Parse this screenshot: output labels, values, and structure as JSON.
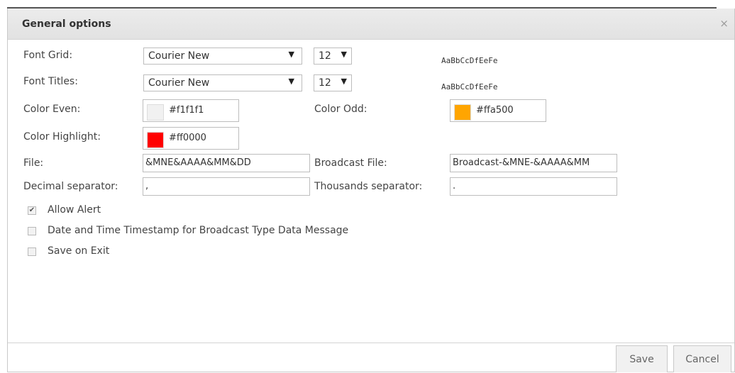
{
  "dialog": {
    "title": "General options",
    "close_icon": "×"
  },
  "form": {
    "font_grid": {
      "label": "Font Grid:",
      "font": "Courier New",
      "size": "12",
      "sample": "AaBbCcDfEeFe"
    },
    "font_titles": {
      "label": "Font Titles:",
      "font": "Courier New",
      "size": "12",
      "sample": "AaBbCcDfEeFe"
    },
    "color_even": {
      "label": "Color Even:",
      "value": "#f1f1f1",
      "swatch": "#f1f1f1"
    },
    "color_odd": {
      "label": "Color Odd:",
      "value": "#ffa500",
      "swatch": "#ffa500"
    },
    "color_highlight": {
      "label": "Color Highlight:",
      "value": "#ff0000",
      "swatch": "#ff0000"
    },
    "file": {
      "label": "File:",
      "value": "&MNE&AAAA&MM&DD"
    },
    "broadcast_file": {
      "label": "Broadcast File:",
      "value": "Broadcast-&MNE-&AAAA&MM"
    },
    "decimal_separator": {
      "label": "Decimal separator:",
      "value": ","
    },
    "thousands_separator": {
      "label": "Thousands separator:",
      "value": "."
    }
  },
  "checkboxes": [
    {
      "label": "Allow Alert",
      "checked": true
    },
    {
      "label": "Date and Time Timestamp for Broadcast Type Data Message",
      "checked": false
    },
    {
      "label": "Save on Exit",
      "checked": false
    }
  ],
  "buttons": {
    "save": "Save",
    "cancel": "Cancel"
  }
}
